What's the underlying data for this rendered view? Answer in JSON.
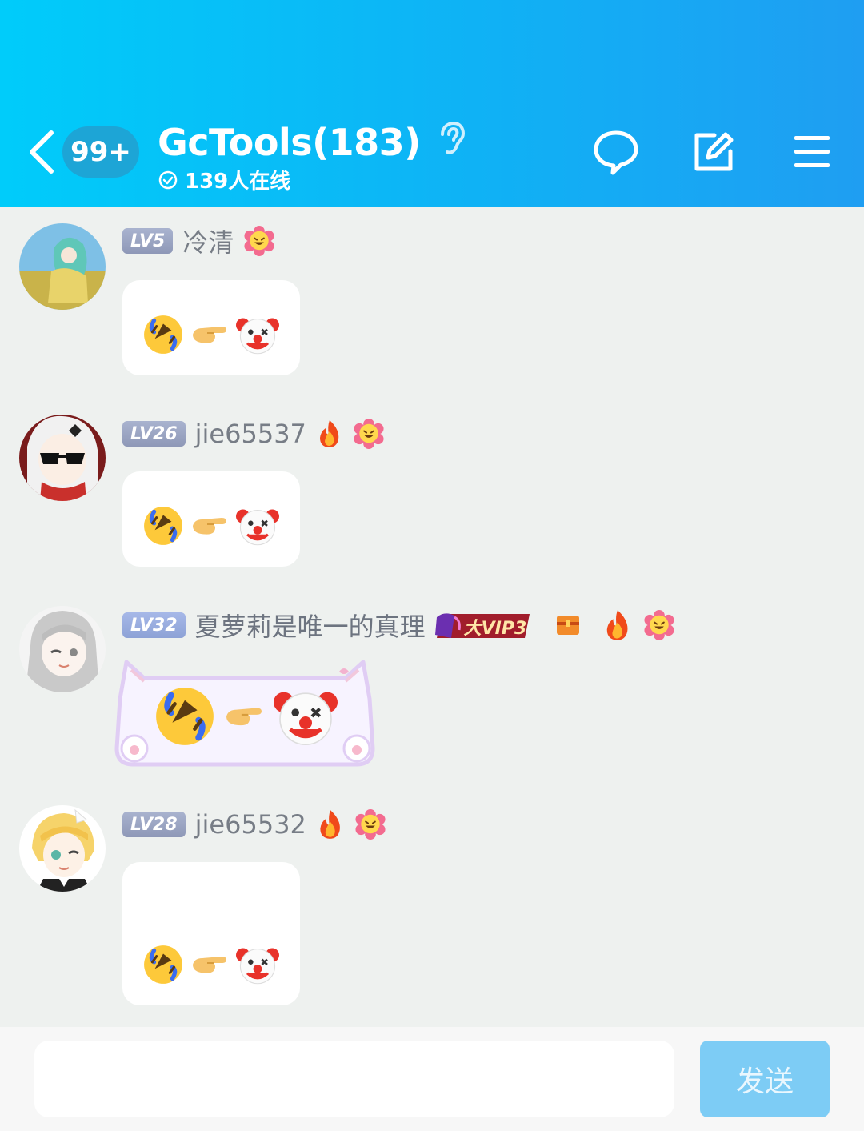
{
  "header": {
    "unread_count": "99+",
    "group_title": "GcTools(183)",
    "online_text": "139人在线",
    "colors": {
      "gradient_start": "#00ccfa",
      "gradient_end": "#1f9ef2"
    }
  },
  "messages": [
    {
      "level": "LV5",
      "username": "冷清",
      "avatar": "avatar-anime-girl-green",
      "badges": [
        "smile-flower-icon"
      ],
      "content": "🤣👉🤡"
    },
    {
      "level": "LV26",
      "username": "jie65537",
      "avatar": "avatar-anime-sunglasses",
      "badges": [
        "fire-icon",
        "smile-flower-icon"
      ],
      "content": "🤣👉🤡"
    },
    {
      "level": "LV32",
      "username": "夏萝莉是唯一的真理",
      "avatar": "avatar-anime-grey-hair",
      "badges": [
        "vip-badge",
        "chest-icon",
        "fire-icon",
        "smile-flower-icon"
      ],
      "vip_text": "大VIP3",
      "content": "🤣👉🤡",
      "bubble_style": "cat-frame"
    },
    {
      "level": "LV28",
      "username": "jie65532",
      "avatar": "avatar-anime-blonde",
      "badges": [
        "fire-icon",
        "smile-flower-icon"
      ],
      "content": "🤣👉🤡"
    }
  ],
  "input": {
    "placeholder": "",
    "value": ""
  },
  "send_label": "发送"
}
